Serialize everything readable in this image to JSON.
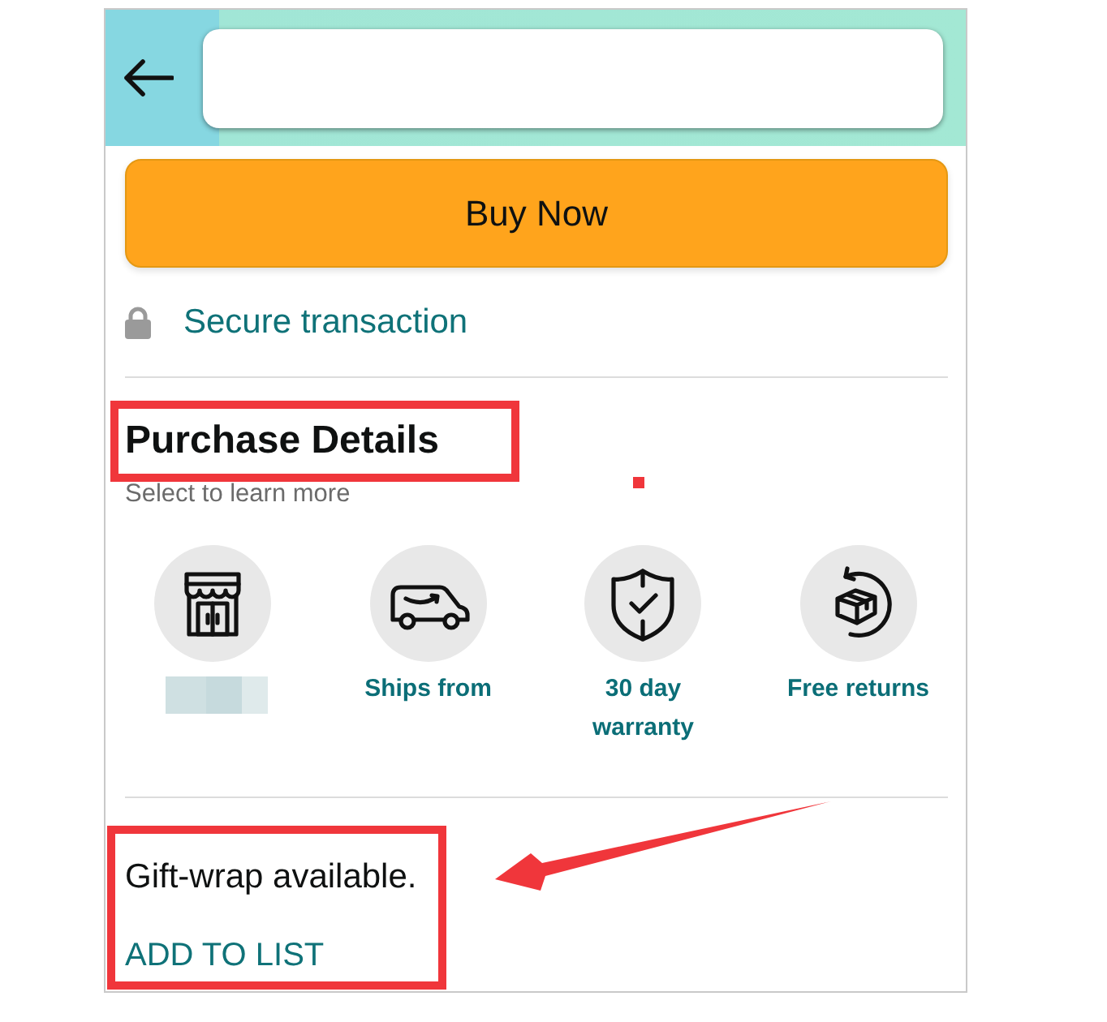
{
  "buy_button": {
    "label": "Buy Now"
  },
  "secure": {
    "label": "Secure transaction"
  },
  "purchase_details": {
    "title": "Purchase Details",
    "subtitle": "Select to learn more",
    "features": [
      {
        "kind": "store",
        "redacted": true
      },
      {
        "kind": "van",
        "redacted": false,
        "label": "Ships from"
      },
      {
        "kind": "shield",
        "redacted": false,
        "label": "30 day warranty"
      },
      {
        "kind": "returns",
        "redacted": false,
        "label": "Free returns"
      }
    ]
  },
  "gift": {
    "text": "Gift-wrap available.",
    "link": "ADD TO LIST"
  }
}
